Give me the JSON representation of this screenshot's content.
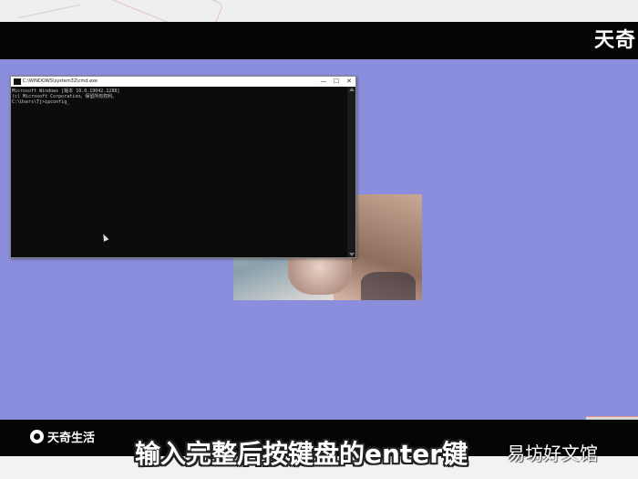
{
  "header": {
    "logo_text": "天奇"
  },
  "cmd_window": {
    "title": "C:\\WINDOWS\\system32\\cmd.exe",
    "controls": {
      "minimize": "—",
      "maximize": "☐",
      "close": "✕"
    },
    "console_lines": [
      "Microsoft Windows [版本 10.0.19042.1288]",
      "(c) Microsoft Corporation。保留所有权利。",
      "",
      "C:\\Users\\Tj>ipconfig_"
    ]
  },
  "footer": {
    "brand": "天奇生活",
    "subtitle": "输入完整后按键盘的enter键",
    "watermark": "易坊好文馆"
  },
  "colors": {
    "desktop": "#8a8edc",
    "bars": "#050505"
  }
}
